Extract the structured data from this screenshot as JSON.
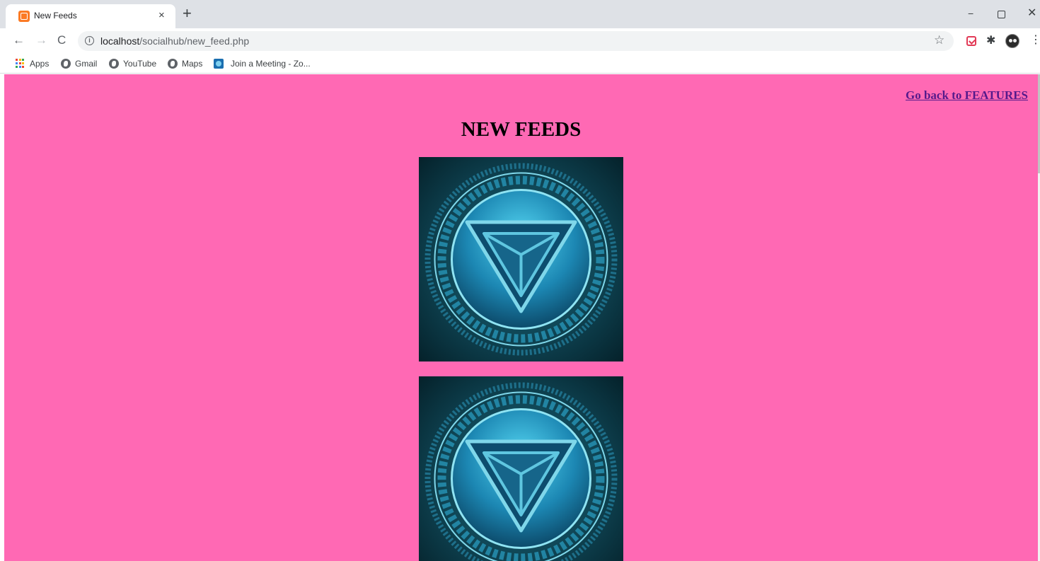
{
  "browser": {
    "tab": {
      "title": "New Feeds",
      "close_glyph": "×",
      "favicon": "xampp-icon"
    },
    "new_tab_glyph": "+",
    "window_controls": {
      "minimize": "−",
      "close": "✕"
    },
    "nav": {
      "back": "←",
      "forward": "→",
      "reload": "C"
    },
    "address": {
      "host": "localhost",
      "path": "/socialhub/new_feed.php"
    },
    "bookmarks": [
      {
        "label": "Apps",
        "icon": "apps-grid-icon"
      },
      {
        "label": "Gmail",
        "icon": "globe-icon"
      },
      {
        "label": "YouTube",
        "icon": "globe-icon"
      },
      {
        "label": "Maps",
        "icon": "globe-icon"
      },
      {
        "label": "Join a Meeting - Zo...",
        "icon": "zoom-icon"
      }
    ]
  },
  "page": {
    "background_color": "#ff69b4",
    "back_link": "Go back to FEATURES",
    "title": "NEW FEEDS",
    "feed_images": [
      {
        "icon": "triangle-emblem-image"
      },
      {
        "icon": "triangle-emblem-image"
      }
    ]
  }
}
